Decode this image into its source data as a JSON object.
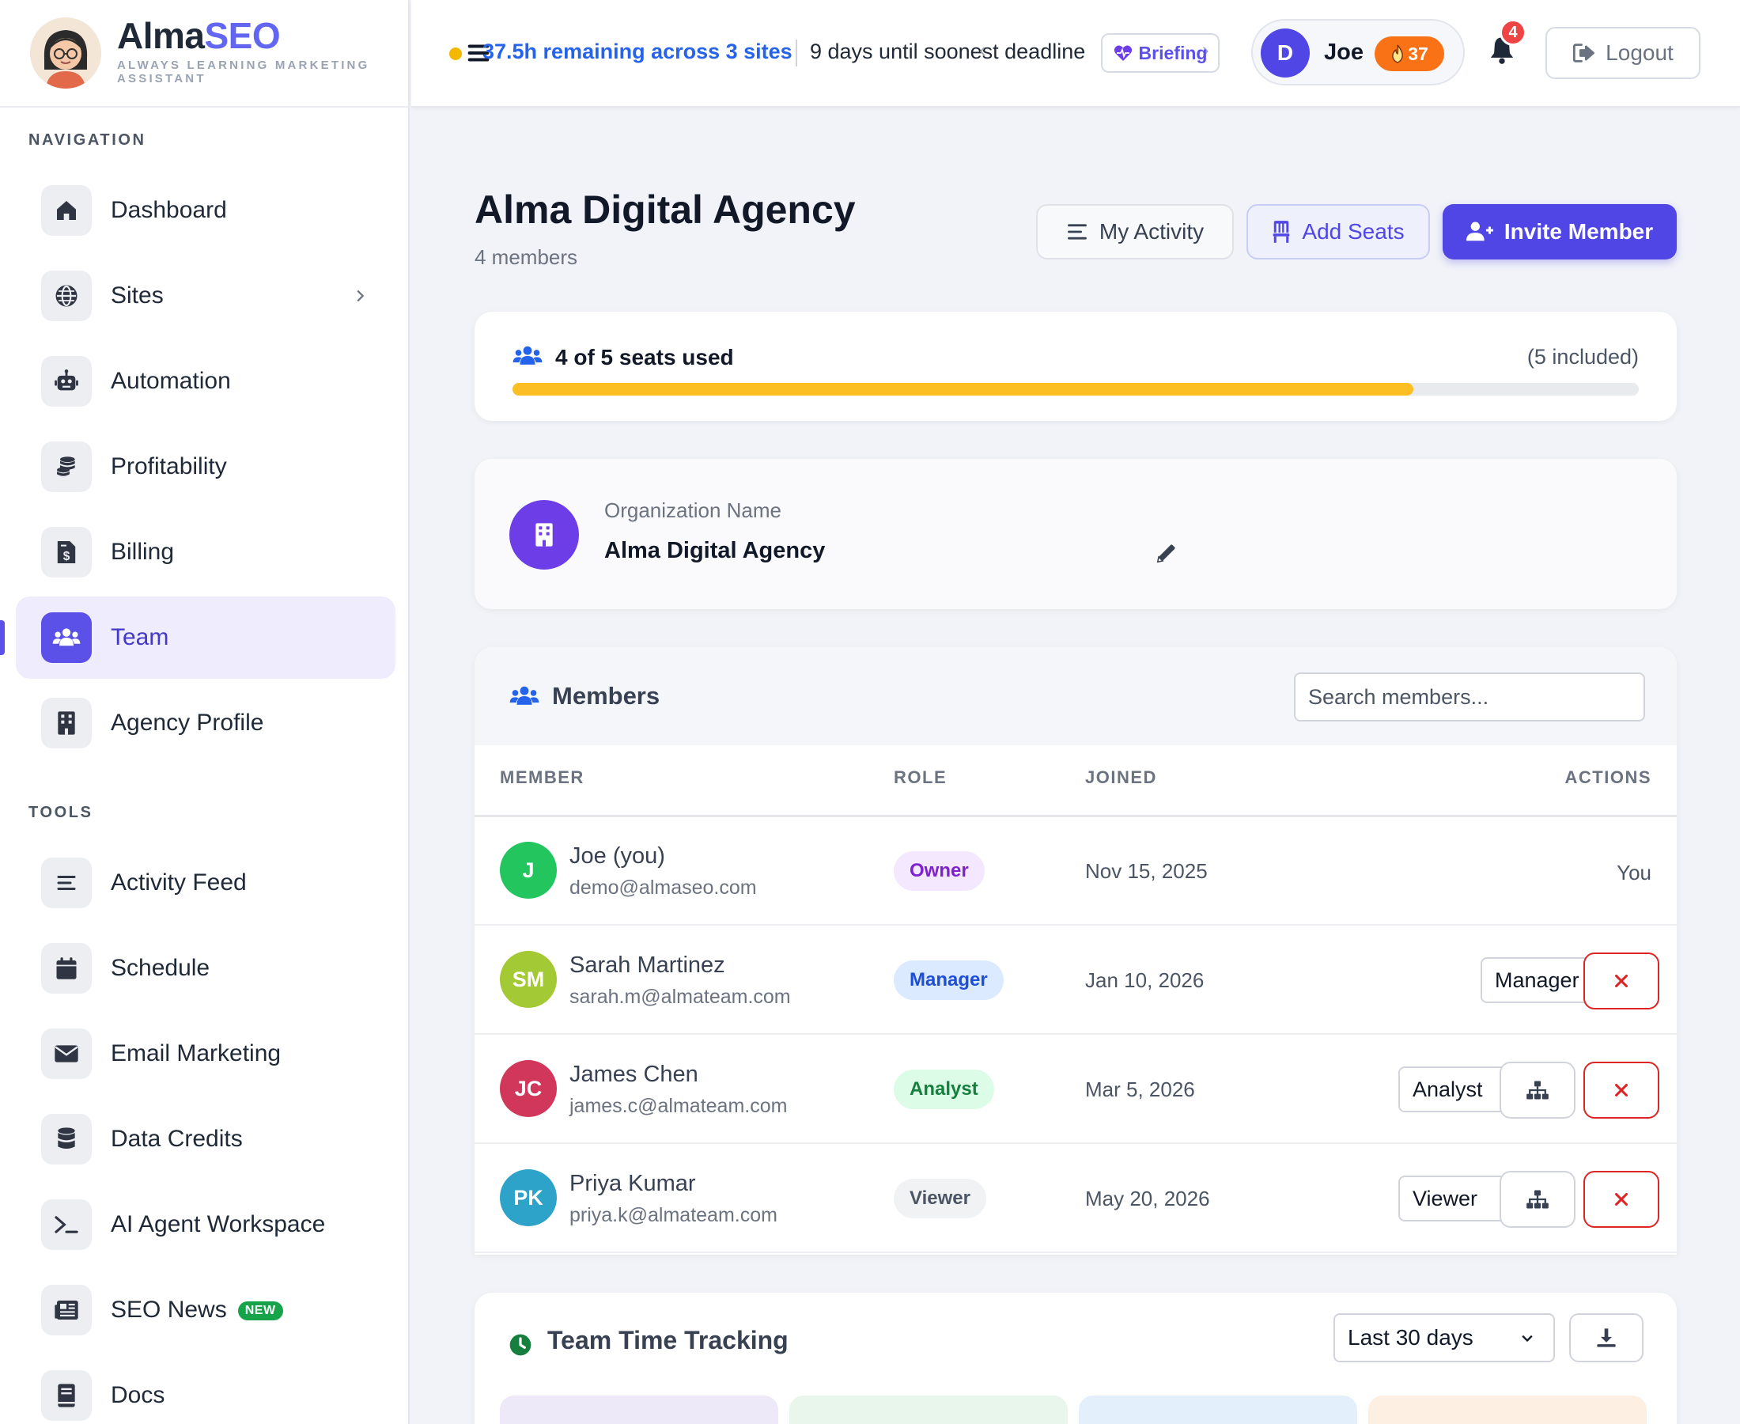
{
  "brand": {
    "name_prefix": "Alma",
    "name_suffix": "SEO",
    "tagline": "ALWAYS LEARNING MARKETING ASSISTANT"
  },
  "sidebar": {
    "nav_label": "NAVIGATION",
    "tools_label": "TOOLS",
    "nav_items": [
      {
        "label": "Dashboard",
        "icon": "home-icon"
      },
      {
        "label": "Sites",
        "icon": "globe-icon",
        "has_submenu": true
      },
      {
        "label": "Automation",
        "icon": "robot-icon"
      },
      {
        "label": "Profitability",
        "icon": "coins-icon"
      },
      {
        "label": "Billing",
        "icon": "invoice-icon"
      },
      {
        "label": "Team",
        "icon": "users-icon",
        "active": true
      },
      {
        "label": "Agency Profile",
        "icon": "building-icon"
      }
    ],
    "tool_items": [
      {
        "label": "Activity Feed",
        "icon": "list-icon"
      },
      {
        "label": "Schedule",
        "icon": "calendar-icon"
      },
      {
        "label": "Email Marketing",
        "icon": "envelope-icon"
      },
      {
        "label": "Data Credits",
        "icon": "database-icon"
      },
      {
        "label": "AI Agent Workspace",
        "icon": "terminal-icon"
      },
      {
        "label": "SEO News",
        "icon": "newspaper-icon",
        "badge": "NEW"
      },
      {
        "label": "Docs",
        "icon": "book-icon"
      }
    ]
  },
  "topbar": {
    "remaining": "37.5h remaining across 3 sites",
    "deadline": "9 days until soonest deadline",
    "briefing_label": "Briefing",
    "user_initial": "D",
    "user_name": "Joe",
    "streak": "37",
    "notifications": "4",
    "logout_label": "Logout"
  },
  "page": {
    "title": "Alma Digital Agency",
    "subtitle": "4 members",
    "my_activity_label": "My Activity",
    "add_seats_label": "Add Seats",
    "invite_label": "Invite Member"
  },
  "seats": {
    "text": "4 of 5 seats used",
    "included": "(5 included)",
    "used": 4,
    "total": 5,
    "bar_color": "#fbbf24"
  },
  "organization": {
    "label": "Organization Name",
    "value": "Alma Digital Agency"
  },
  "members": {
    "title": "Members",
    "search_placeholder": "Search members...",
    "columns": [
      "MEMBER",
      "ROLE",
      "JOINED",
      "ACTIONS"
    ],
    "rows": [
      {
        "initials": "J",
        "avatar_color": "#22c55e",
        "name": "Joe (you)",
        "email": "demo@almaseo.com",
        "role": "Owner",
        "role_bg": "#f3e8ff",
        "role_fg": "#7e22ce",
        "joined": "Nov 15, 2025",
        "action_text": "You"
      },
      {
        "initials": "SM",
        "avatar_color": "#a3c934",
        "name": "Sarah Martinez",
        "email": "sarah.m@almateam.com",
        "role": "Manager",
        "role_bg": "#dbeafe",
        "role_fg": "#1d4ed8",
        "joined": "Jan 10, 2026",
        "select_value": "Manager"
      },
      {
        "initials": "JC",
        "avatar_color": "#d1375a",
        "name": "James Chen",
        "email": "james.c@almateam.com",
        "role": "Analyst",
        "role_bg": "#dcfce7",
        "role_fg": "#15803d",
        "joined": "Mar 5, 2026",
        "select_value": "Analyst"
      },
      {
        "initials": "PK",
        "avatar_color": "#2ea3c9",
        "name": "Priya Kumar",
        "email": "priya.k@almateam.com",
        "role": "Viewer",
        "role_bg": "#f1f2f4",
        "role_fg": "#4b5563",
        "joined": "May 20, 2026",
        "select_value": "Viewer"
      }
    ]
  },
  "time_tracking": {
    "title": "Team Time Tracking",
    "range": "Last 30 days"
  }
}
